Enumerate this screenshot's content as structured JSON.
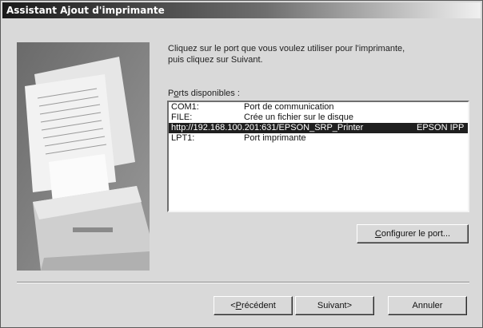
{
  "window": {
    "title": "Assistant Ajout d'imprimante"
  },
  "instructions": {
    "line1": "Cliquez sur le port que vous voulez utiliser pour l'imprimante,",
    "line2": "puis cliquez sur Suivant."
  },
  "ports": {
    "label_prefix": "P",
    "label_accel": "o",
    "label_suffix": "rts disponibles :",
    "items": [
      {
        "port": "COM1:",
        "description": "Port de communication",
        "selected": false
      },
      {
        "port": "FILE:",
        "description": "Crée un fichier sur le disque",
        "selected": false
      },
      {
        "port": "http://192.168.100.201:631/EPSON_SRP_Printer",
        "description": "EPSON IPP",
        "selected": true
      },
      {
        "port": "LPT1:",
        "description": "Port imprimante",
        "selected": false
      }
    ]
  },
  "buttons": {
    "configure_accel": "C",
    "configure_rest": "onfigurer le port...",
    "back_prefix": "< ",
    "back_accel": "P",
    "back_rest": "récédent",
    "next_prefix": "Suivant ",
    "next_suffix": ">",
    "cancel": "Annuler"
  }
}
